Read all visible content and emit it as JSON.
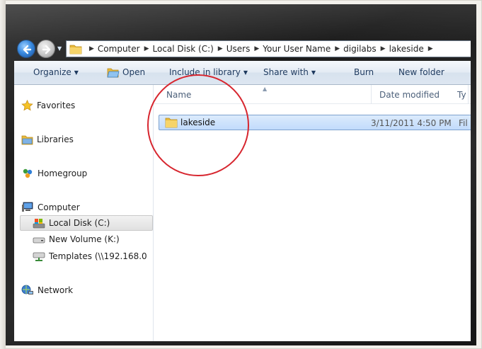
{
  "breadcrumb": [
    "Computer",
    "Local Disk (C:)",
    "Users",
    "Your User Name",
    "digilabs",
    "lakeside"
  ],
  "toolbar": {
    "organize": "Organize",
    "open": "Open",
    "include_in_library": "Include in library",
    "share_with": "Share with",
    "burn": "Burn",
    "new_folder": "New folder"
  },
  "nav_pane": {
    "favorites": "Favorites",
    "libraries": "Libraries",
    "homegroup": "Homegroup",
    "computer": "Computer",
    "local_disk": "Local Disk (C:)",
    "new_volume": "New Volume (K:)",
    "templates": "Templates (\\\\192.168.0",
    "network": "Network"
  },
  "columns": {
    "name": "Name",
    "date_modified": "Date modified",
    "type": "Ty"
  },
  "files": [
    {
      "name": "lakeside",
      "date_modified": "3/11/2011 4:50 PM",
      "type": "Fil"
    }
  ],
  "colors": {
    "annotation_circle": "#d7262f",
    "selection": "#c1dbfc",
    "folder": "#e8b93a"
  }
}
